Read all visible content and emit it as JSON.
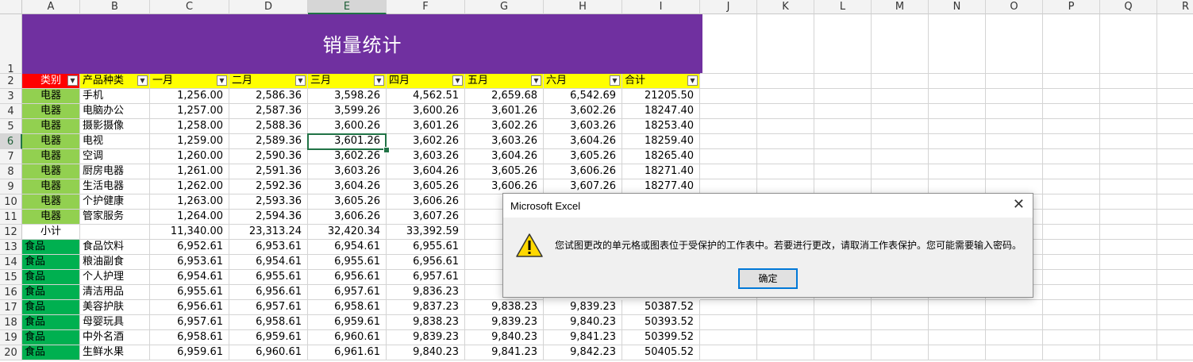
{
  "columns": [
    "A",
    "B",
    "C",
    "D",
    "E",
    "F",
    "G",
    "H",
    "I",
    "J",
    "K",
    "L",
    "M",
    "N",
    "O",
    "P",
    "Q",
    "R"
  ],
  "selected_column": "E",
  "selected_row": "6",
  "row_numbers": [
    "1",
    "2",
    "3",
    "4",
    "5",
    "6",
    "7",
    "8",
    "9",
    "10",
    "11",
    "12",
    "13",
    "14",
    "15",
    "16",
    "17",
    "18",
    "19",
    "20"
  ],
  "title": "销量统计",
  "headers": [
    "类别",
    "产品种类",
    "一月",
    "二月",
    "三月",
    "四月",
    "五月",
    "六月",
    "合计"
  ],
  "rows": [
    [
      "电器",
      "手机",
      "1,256.00",
      "2,586.36",
      "3,598.26",
      "4,562.51",
      "2,659.68",
      "6,542.69",
      "21205.50"
    ],
    [
      "电器",
      "电脑办公",
      "1,257.00",
      "2,587.36",
      "3,599.26",
      "3,600.26",
      "3,601.26",
      "3,602.26",
      "18247.40"
    ],
    [
      "电器",
      "摄影摄像",
      "1,258.00",
      "2,588.36",
      "3,600.26",
      "3,601.26",
      "3,602.26",
      "3,603.26",
      "18253.40"
    ],
    [
      "电器",
      "电视",
      "1,259.00",
      "2,589.36",
      "3,601.26",
      "3,602.26",
      "3,603.26",
      "3,604.26",
      "18259.40"
    ],
    [
      "电器",
      "空调",
      "1,260.00",
      "2,590.36",
      "3,602.26",
      "3,603.26",
      "3,604.26",
      "3,605.26",
      "18265.40"
    ],
    [
      "电器",
      "厨房电器",
      "1,261.00",
      "2,591.36",
      "3,603.26",
      "3,604.26",
      "3,605.26",
      "3,606.26",
      "18271.40"
    ],
    [
      "电器",
      "生活电器",
      "1,262.00",
      "2,592.36",
      "3,604.26",
      "3,605.26",
      "3,606.26",
      "3,607.26",
      "18277.40"
    ],
    [
      "电器",
      "个护健康",
      "1,263.00",
      "2,593.36",
      "3,605.26",
      "3,606.26",
      "3",
      "",
      ""
    ],
    [
      "电器",
      "管家服务",
      "1,264.00",
      "2,594.36",
      "3,606.26",
      "3,607.26",
      "3",
      "",
      ""
    ],
    [
      "小计",
      "",
      "11,340.00",
      "23,313.24",
      "32,420.34",
      "33,392.59",
      "31",
      "",
      ""
    ],
    [
      "食品",
      "食品饮料",
      "6,952.61",
      "6,953.61",
      "6,954.61",
      "6,955.61",
      "6",
      "",
      ""
    ],
    [
      "食品",
      "粮油副食",
      "6,953.61",
      "6,954.61",
      "6,955.61",
      "6,956.61",
      "6",
      "",
      ""
    ],
    [
      "食品",
      "个人护理",
      "6,954.61",
      "6,955.61",
      "6,956.61",
      "6,957.61",
      "6",
      "",
      ""
    ],
    [
      "食品",
      "清洁用品",
      "6,955.61",
      "6,956.61",
      "6,957.61",
      "9,836.23",
      "9",
      "",
      ""
    ],
    [
      "食品",
      "美容护肤",
      "6,956.61",
      "6,957.61",
      "6,958.61",
      "9,837.23",
      "9,838.23",
      "9,839.23",
      "50387.52"
    ],
    [
      "食品",
      "母婴玩具",
      "6,957.61",
      "6,958.61",
      "6,959.61",
      "9,838.23",
      "9,839.23",
      "9,840.23",
      "50393.52"
    ],
    [
      "食品",
      "中外名酒",
      "6,958.61",
      "6,959.61",
      "6,960.61",
      "9,839.23",
      "9,840.23",
      "9,841.23",
      "50399.52"
    ],
    [
      "食品",
      "生鲜水果",
      "6,959.61",
      "6,960.61",
      "6,961.61",
      "9,840.23",
      "9,841.23",
      "9,842.23",
      "50405.52"
    ]
  ],
  "dialog": {
    "title": "Microsoft Excel",
    "message": "您试图更改的单元格或图表位于受保护的工作表中。若要进行更改，请取消工作表保护。您可能需要输入密码。",
    "ok_label": "确定",
    "close_symbol": "✕",
    "warning_icon": "warning-icon"
  },
  "colors": {
    "title_bg": "#7030a0",
    "header_bg": "#ffff00",
    "category_header_bg": "#ff0000",
    "electric_bg": "#92d050",
    "food_bg": "#00b050",
    "selection": "#217346"
  }
}
